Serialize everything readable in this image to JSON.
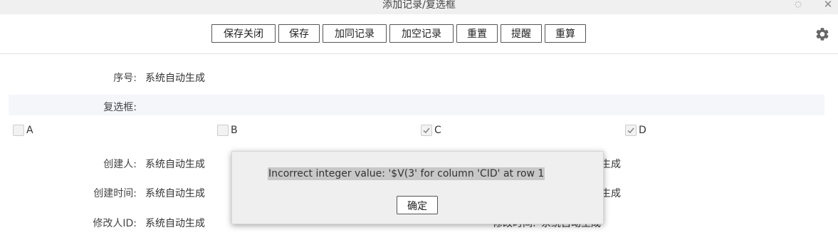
{
  "window": {
    "title": "添加记录/复选框"
  },
  "toolbar": {
    "buttons": [
      "保存关闭",
      "保存",
      "加同记录",
      "加空记录",
      "重置",
      "提醒",
      "重算"
    ]
  },
  "form": {
    "seq": {
      "label": "序号:",
      "value": "系统自动生成"
    },
    "checkbox_field": {
      "label": "复选框:"
    },
    "options": [
      {
        "label": "A",
        "checked": false
      },
      {
        "label": "B",
        "checked": false
      },
      {
        "label": "C",
        "checked": true
      },
      {
        "label": "D",
        "checked": true
      }
    ],
    "creator": {
      "label": "创建人:",
      "value": "系统自动生成",
      "right_value_partial": "生成"
    },
    "created_time": {
      "label": "创建时间:",
      "value": "系统自动生成",
      "right_value_partial": "生成"
    },
    "modifier_id": {
      "label": "修改人ID:",
      "value": "系统自动生成",
      "right_label_partial": "修改时间:",
      "right_value_partial": "系统自动生成"
    }
  },
  "dialog": {
    "message": "Incorrect integer value: '$V(3' for column 'CID' at row 1",
    "ok_label": "确定"
  },
  "icons": {
    "restore": "restore-icon",
    "close": "close-icon",
    "settings": "gear-icon"
  }
}
